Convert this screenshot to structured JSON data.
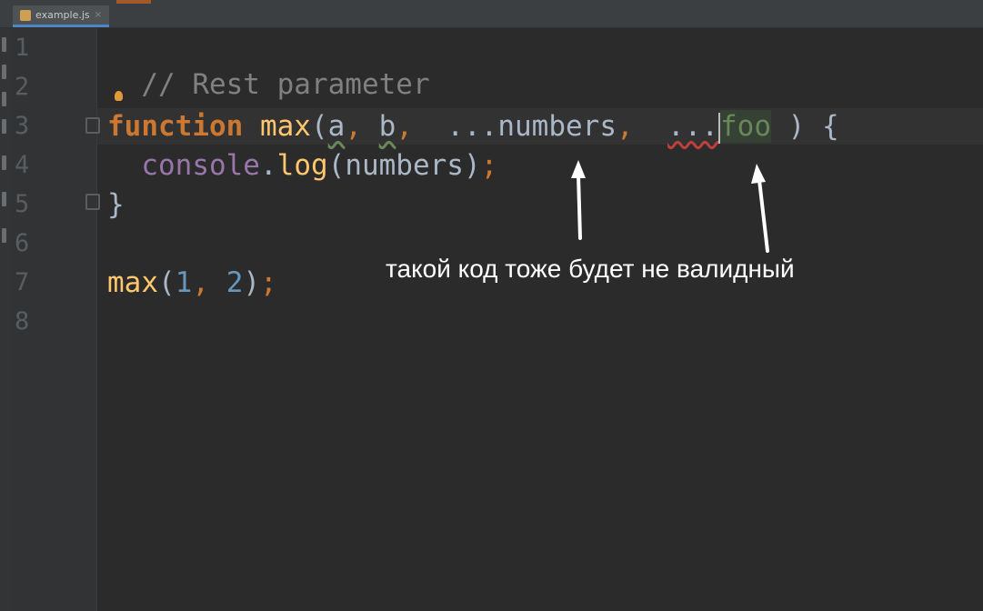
{
  "tab": {
    "label": "example.js",
    "close": "×"
  },
  "gutter": {
    "line_numbers": [
      "1",
      "2",
      "3",
      "4",
      "5",
      "6",
      "7",
      "8"
    ]
  },
  "code": {
    "line1": "// Rest parameter",
    "line3": {
      "keyword": "function",
      "name": "max",
      "open": "(",
      "param_a": "a",
      "comma1": ",",
      "param_b": "b",
      "comma2": ",",
      "spread1": "...",
      "numbers": "numbers",
      "comma3": ",",
      "spread2": "...",
      "foo": "foo",
      "close": " ) {"
    },
    "line4": {
      "object": "console",
      "dot": ".",
      "method": "log",
      "args": "(numbers)",
      "semi": ";"
    },
    "line5": "}",
    "line7": {
      "name": "max",
      "open": "(",
      "arg1": "1",
      "comma": ",",
      "arg2": "2",
      "close": ")",
      "semi": ";"
    }
  },
  "annotation": {
    "text": "такой код тоже будет не валидный"
  },
  "colors": {
    "background": "#2b2b2b",
    "keyword": "#cc7832",
    "function_name": "#ffc66d",
    "comment": "#808080",
    "number": "#6897bb",
    "object": "#9876aa",
    "error_underline": "#bc3f3c",
    "annotation": "#ffffff"
  },
  "icons": [
    "file-js-icon",
    "intention-bulb-icon",
    "fold-marker-icon",
    "arrow-up-icon"
  ]
}
